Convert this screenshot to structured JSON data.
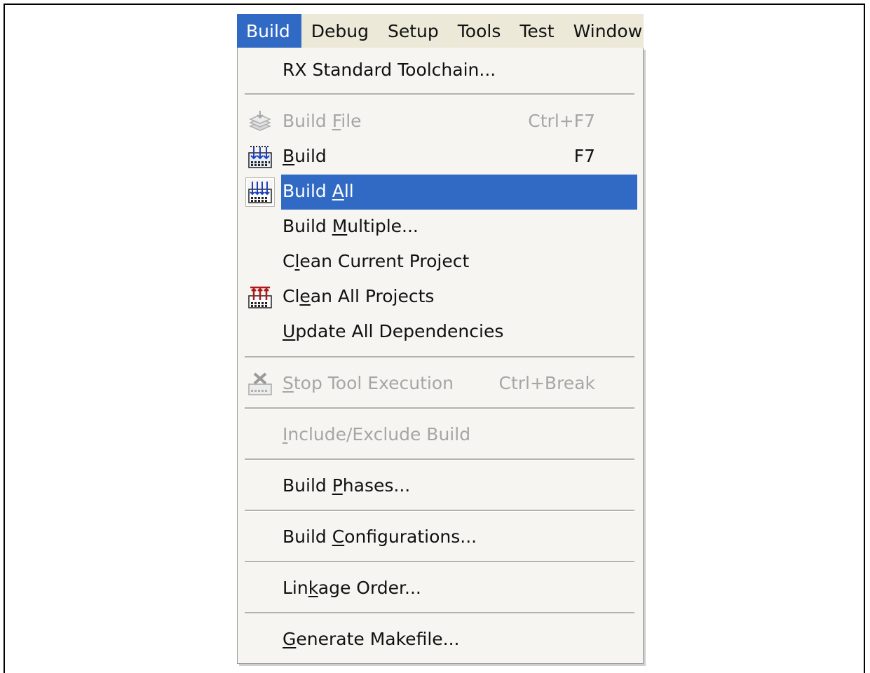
{
  "menubar": {
    "items": [
      "Build",
      "Debug",
      "Setup",
      "Tools",
      "Test",
      "Window"
    ]
  },
  "menu": {
    "toolchain": {
      "label": "RX Standard Toolchain..."
    },
    "build_file": {
      "pre": "Build ",
      "acc": "F",
      "post": "ile",
      "shortcut": "Ctrl+F7",
      "icon": "build-file-icon"
    },
    "build": {
      "pre": "",
      "acc": "B",
      "post": "uild",
      "shortcut": "F7",
      "icon": "build-icon"
    },
    "build_all": {
      "pre": "Build ",
      "acc": "A",
      "post": "ll",
      "icon": "build-all-icon"
    },
    "build_multiple": {
      "pre": "Build ",
      "acc": "M",
      "post": "ultiple..."
    },
    "clean_current": {
      "pre": "C",
      "acc": "l",
      "post": "ean Current Project"
    },
    "clean_all": {
      "pre": "Cl",
      "acc": "e",
      "post": "an All Projects",
      "icon": "clean-all-icon"
    },
    "update_deps": {
      "pre": "",
      "acc": "U",
      "post": "pdate All Dependencies"
    },
    "stop_tool": {
      "pre": "",
      "acc": "S",
      "post": "top Tool Execution",
      "shortcut": "Ctrl+Break",
      "icon": "stop-tool-icon"
    },
    "include_exclude": {
      "pre": "",
      "acc": "I",
      "post": "nclude/Exclude Build"
    },
    "build_phases": {
      "pre": "Build ",
      "acc": "P",
      "post": "hases..."
    },
    "build_configs": {
      "pre": "Build ",
      "acc": "C",
      "post": "onfigurations..."
    },
    "linkage_order": {
      "pre": "Lin",
      "acc": "k",
      "post": "age Order..."
    },
    "generate_makefile": {
      "pre": "",
      "acc": "G",
      "post": "enerate Makefile..."
    }
  },
  "colors": {
    "highlight": "#316ac5",
    "menu_bg": "#f6f5f1",
    "menubar_bg": "#ece9d8",
    "disabled_text": "#a6a6a6"
  }
}
